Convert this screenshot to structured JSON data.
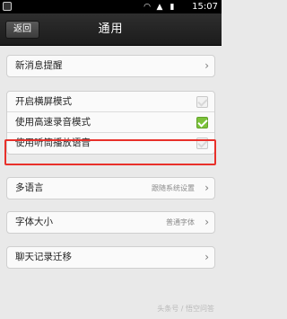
{
  "status_bar": {
    "time": "15:07",
    "icons": [
      "wifi-icon",
      "signal-icon",
      "battery-icon"
    ]
  },
  "header": {
    "back_label": "返回",
    "title": "通用"
  },
  "groups": {
    "notifications": {
      "items": [
        {
          "label": "新消息提醒"
        }
      ]
    },
    "toggles": {
      "items": [
        {
          "label": "开启横屏模式",
          "checked": false
        },
        {
          "label": "使用高速录音模式",
          "checked": true
        },
        {
          "label": "使用听筒播放语音",
          "checked": false
        }
      ]
    },
    "language": {
      "items": [
        {
          "label": "多语言",
          "value": "跟随系统设置"
        }
      ]
    },
    "font": {
      "items": [
        {
          "label": "字体大小",
          "value": "普通字体"
        }
      ]
    },
    "chat": {
      "items": [
        {
          "label": "聊天记录迁移"
        }
      ]
    }
  },
  "colors": {
    "highlight_border": "#e8302a",
    "checkbox_on": "#7cc23a"
  },
  "watermark": "头条号 / 悟空问答"
}
